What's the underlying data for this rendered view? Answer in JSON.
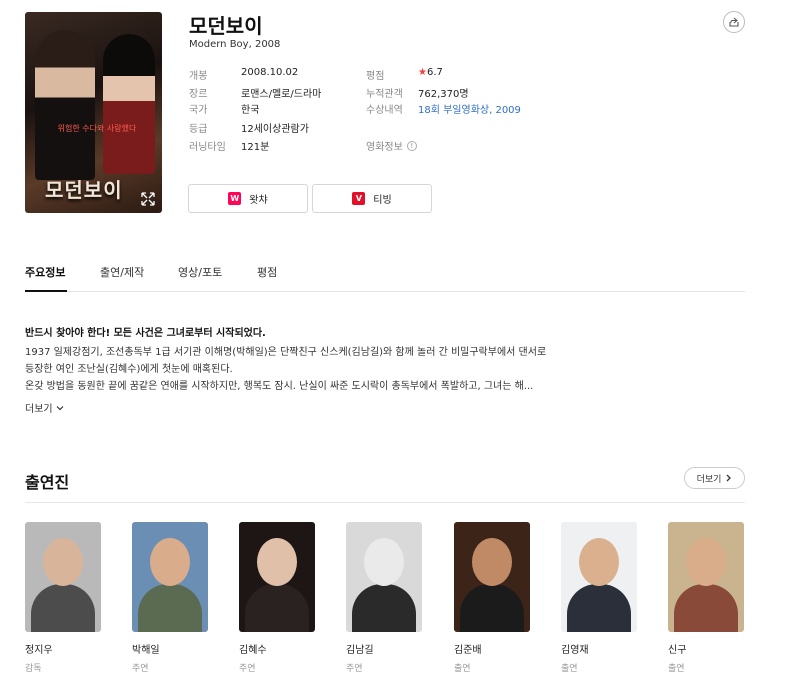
{
  "poster": {
    "title_text": "모던보이",
    "tagline": "위험한 수다와 사랑했다"
  },
  "movie": {
    "title": "모던보이",
    "subtitle": "Modern Boy, 2008"
  },
  "info": {
    "release_label": "개봉",
    "release": "2008.10.02",
    "genre_label": "장르",
    "genre": "로맨스/멜로/드라마",
    "country_label": "국가",
    "country": "한국",
    "rating_label": "등급",
    "rating": "12세이상관람가",
    "runtime_label": "러닝타임",
    "runtime": "121분",
    "score_label": "평점",
    "score": "6.7",
    "audience_label": "누적관객",
    "audience": "762,370명",
    "award_label": "수상내역",
    "award": "18회 부일영화상, 2009",
    "movieinfo_label": "영화정보"
  },
  "ott": [
    {
      "label": "왓챠",
      "logo": "W",
      "color": "#ff0558"
    },
    {
      "label": "티빙",
      "logo": "V",
      "color": "#e2102a"
    }
  ],
  "tabs": [
    "주요정보",
    "출연/제작",
    "영상/포토",
    "평점"
  ],
  "synopsis": {
    "headline": "반드시 찾아야 한다! 모든 사건은 그녀로부터 시작되었다.",
    "lines": [
      "1937 일제강점기, 조선총독부 1급 서기관 이해명(박해일)은 단짝친구 신스케(김남길)와 함께 놀러 간 비밀구락부에서 댄서로",
      "등장한 여인 조난실(김혜수)에게 첫눈에 매혹된다.",
      "온갖 방법을 동원한 끝에 꿈같은 연애를 시작하지만, 행복도 잠시. 난실이 싸준 도시락이 총독부에서 폭발하고, 그녀는 해..."
    ],
    "more": "더보기"
  },
  "cast_section": {
    "title": "출연진",
    "more": "더보기",
    "members": [
      {
        "name": "정지우",
        "role": "감독",
        "bg": "#b9b9b9",
        "skin": "#d7b49a",
        "cloth": "#4c4c4c"
      },
      {
        "name": "박해일",
        "role": "주연",
        "bg": "#6b8fb4",
        "skin": "#d9ad8c",
        "cloth": "#5b6b52"
      },
      {
        "name": "김혜수",
        "role": "주연",
        "bg": "#1d1614",
        "skin": "#e0c0a8",
        "cloth": "#2a2220"
      },
      {
        "name": "김남길",
        "role": "주연",
        "bg": "#d9d9d9",
        "skin": "#eaeaea",
        "cloth": "#2a2a2a"
      },
      {
        "name": "김준배",
        "role": "출연",
        "bg": "#3d2418",
        "skin": "#c08a66",
        "cloth": "#1b1b1b"
      },
      {
        "name": "김영재",
        "role": "출연",
        "bg": "#eef0f2",
        "skin": "#dbb08e",
        "cloth": "#2a2f3a"
      },
      {
        "name": "신구",
        "role": "출연",
        "bg": "#c9b48f",
        "skin": "#d9ad8a",
        "cloth": "#8a4a3a"
      }
    ]
  },
  "colors": {
    "accent_link": "#2f6fc4",
    "star": "#ff3b3b"
  }
}
